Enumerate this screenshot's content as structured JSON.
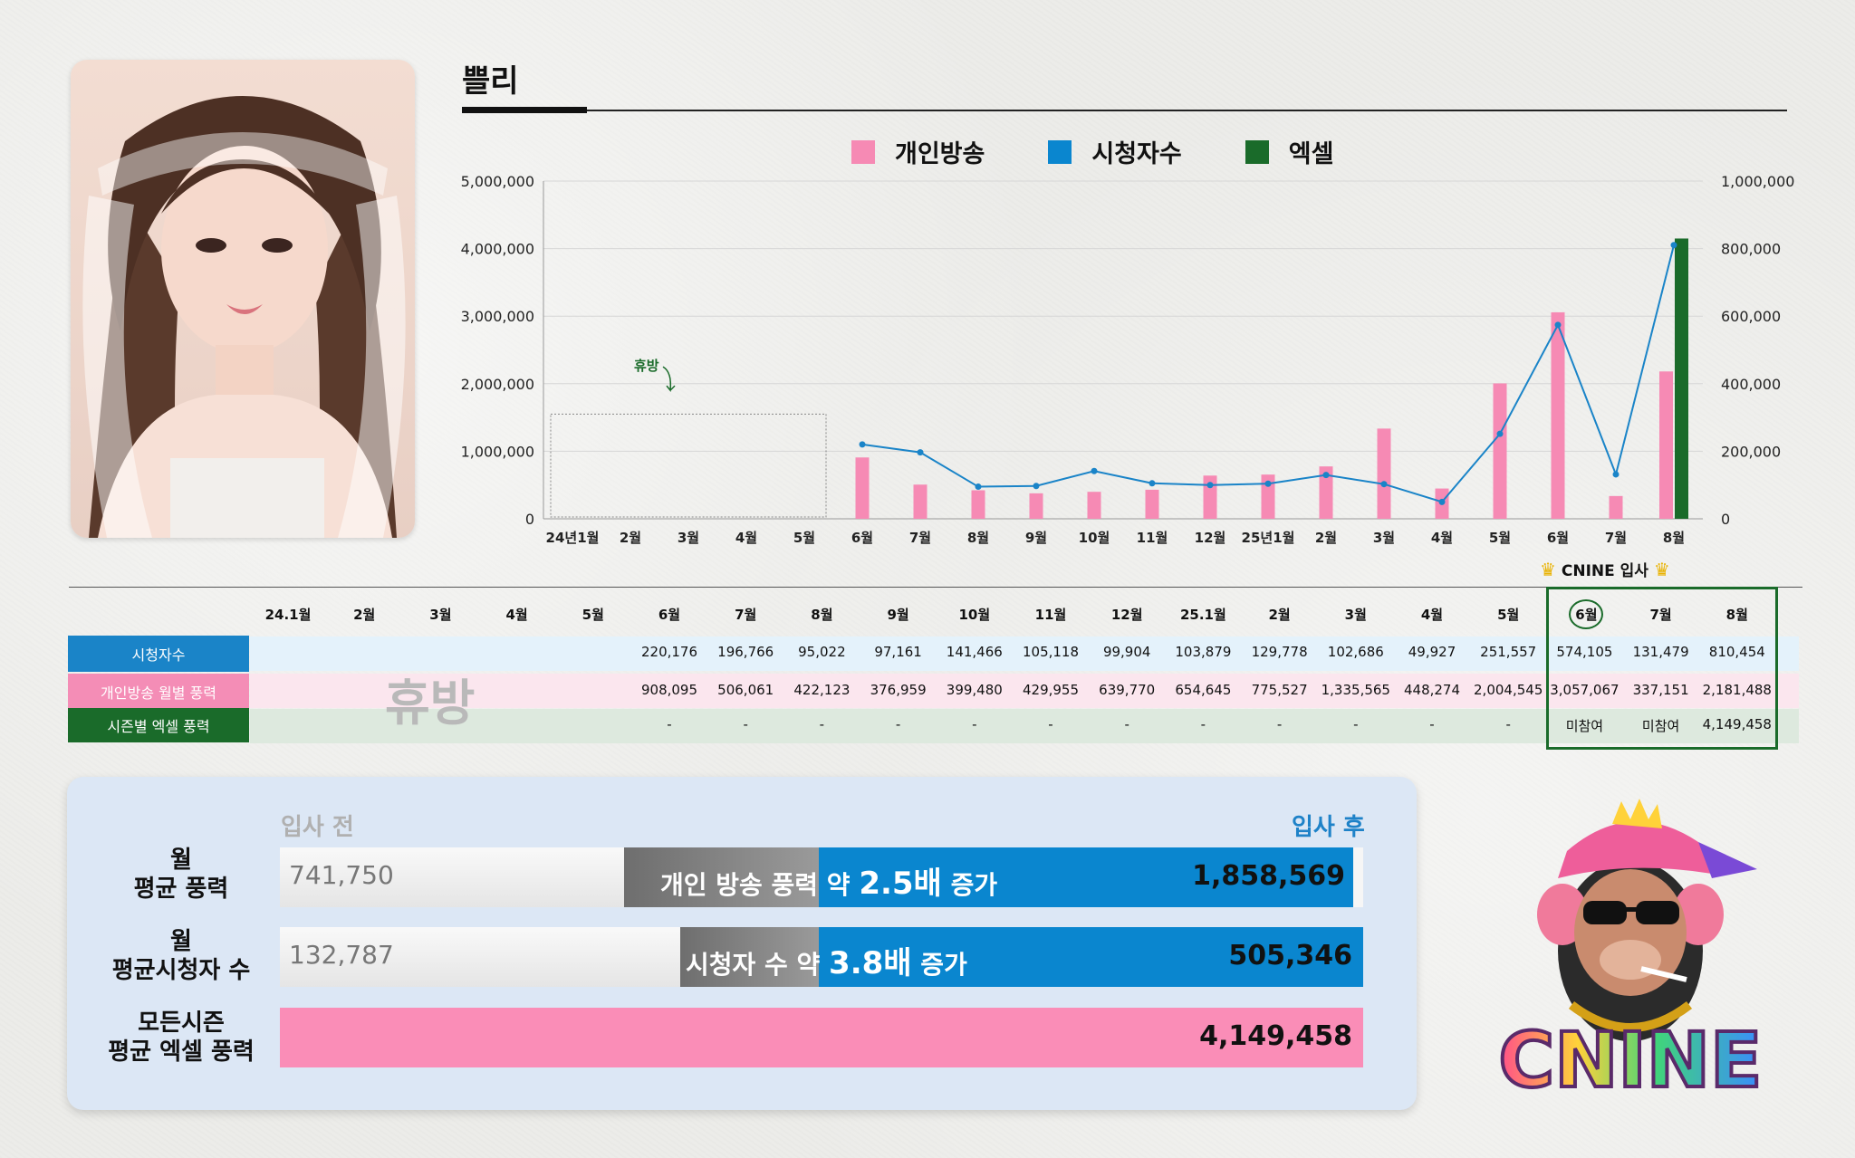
{
  "streamer_name": "쁠리",
  "legend": [
    {
      "label": "개인방송",
      "color": "#f68ab4"
    },
    {
      "label": "시청자수",
      "color": "#0a86cf"
    },
    {
      "label": "엑셀",
      "color": "#1a6b2a"
    }
  ],
  "chart_data": {
    "type": "bar",
    "categories": [
      "24년1월",
      "2월",
      "3월",
      "4월",
      "5월",
      "6월",
      "7월",
      "8월",
      "9월",
      "10월",
      "11월",
      "12월",
      "25년1월",
      "2월",
      "3월",
      "4월",
      "5월",
      "6월",
      "7월",
      "8월"
    ],
    "y_left": {
      "ylim": [
        0,
        5000000
      ],
      "ticks": [
        "0",
        "1,000,000",
        "2,000,000",
        "3,000,000",
        "4,000,000",
        "5,000,000"
      ]
    },
    "y_right": {
      "ylim": [
        0,
        1000000
      ],
      "ticks": [
        "0",
        "200,000",
        "400,000",
        "600,000",
        "800,000",
        "1,000,000"
      ]
    },
    "grid": true,
    "legend_position": "top",
    "annotation": "휴방",
    "series": [
      {
        "name": "개인방송",
        "type": "bar",
        "axis": "left",
        "values": [
          null,
          null,
          null,
          null,
          null,
          908095,
          506061,
          422123,
          376959,
          399480,
          429955,
          639770,
          654645,
          775527,
          1335565,
          448274,
          2004545,
          3057067,
          337151,
          2181488
        ]
      },
      {
        "name": "시청자수",
        "type": "line",
        "axis": "right",
        "values": [
          null,
          null,
          null,
          null,
          null,
          220176,
          196766,
          95022,
          97161,
          141466,
          105118,
          99904,
          103879,
          129778,
          102686,
          49927,
          251557,
          574105,
          131479,
          810454
        ]
      },
      {
        "name": "엑셀",
        "type": "bar",
        "axis": "left",
        "values": [
          null,
          null,
          null,
          null,
          null,
          null,
          null,
          null,
          null,
          null,
          null,
          null,
          null,
          null,
          null,
          null,
          null,
          null,
          null,
          4149458
        ]
      }
    ]
  },
  "table": {
    "months": [
      "24.1월",
      "2월",
      "3월",
      "4월",
      "5월",
      "6월",
      "7월",
      "8월",
      "9월",
      "10월",
      "11월",
      "12월",
      "25.1월",
      "2월",
      "3월",
      "4월",
      "5월",
      "6월",
      "7월",
      "8월"
    ],
    "rows": [
      {
        "label": "시청자수",
        "cells": [
          "",
          "",
          "",
          "",
          "",
          "220,176",
          "196,766",
          "95,022",
          "97,161",
          "141,466",
          "105,118",
          "99,904",
          "103,879",
          "129,778",
          "102,686",
          "49,927",
          "251,557",
          "574,105",
          "131,479",
          "810,454"
        ]
      },
      {
        "label": "개인방송 월별 풍력",
        "cells": [
          "",
          "",
          "",
          "",
          "",
          "908,095",
          "506,061",
          "422,123",
          "376,959",
          "399,480",
          "429,955",
          "639,770",
          "654,645",
          "775,527",
          "1,335,565",
          "448,274",
          "2,004,545",
          "3,057,067",
          "337,151",
          "2,181,488"
        ]
      },
      {
        "label": "시즌별 엑셀 풍력",
        "cells": [
          "",
          "",
          "",
          "",
          "",
          "-",
          "-",
          "-",
          "-",
          "-",
          "-",
          "-",
          "-",
          "-",
          "-",
          "-",
          "-",
          "미참여",
          "미참여",
          "4,149,458"
        ]
      }
    ],
    "break_label": "휴방",
    "join_label": "CNINE 입사"
  },
  "summary": {
    "before_label": "입사 전",
    "after_label": "입사 후",
    "rows": [
      {
        "label1": "월",
        "label2": "평균 풍력",
        "before": "741,750",
        "after": "1,858,569",
        "note_pre": "개인 방송 풍력 약 ",
        "note_num": "2.5배",
        "note_post": " 증가"
      },
      {
        "label1": "월",
        "label2": "평균시청자 수",
        "before": "132,787",
        "after": "505,346",
        "note_pre": "시청자 수 약 ",
        "note_num": "3.8배",
        "note_post": " 증가"
      },
      {
        "label1": "모든시즌",
        "label2": "평균 엑셀 풍력",
        "value": "4,149,458"
      }
    ]
  },
  "logo_text": "CNINE"
}
